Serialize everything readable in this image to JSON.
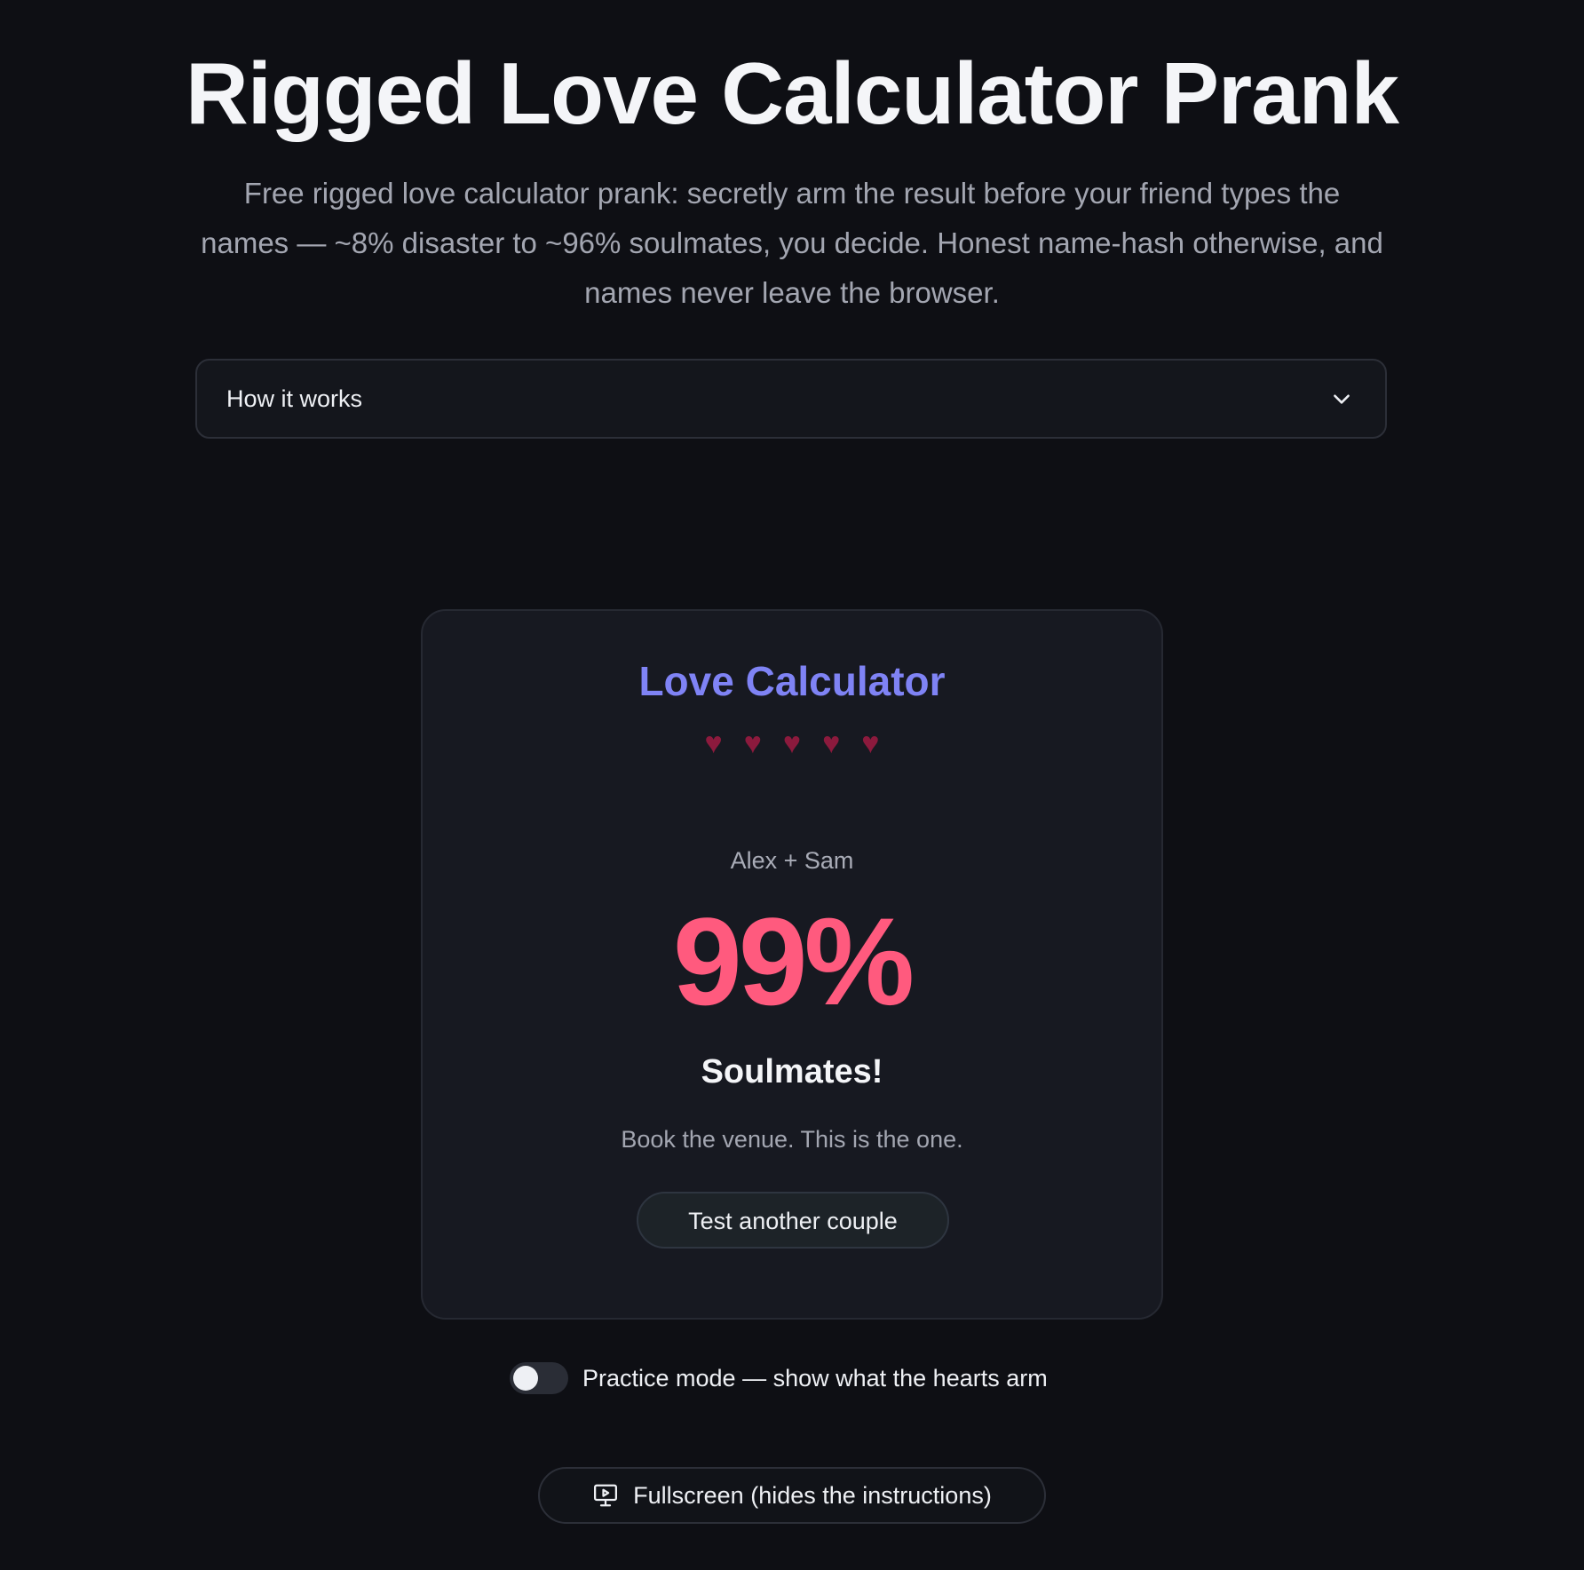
{
  "header": {
    "title": "Rigged Love Calculator Prank",
    "subtitle": "Free rigged love calculator prank: secretly arm the result before your friend types the names — ~8% disaster to ~96% soulmates, you decide. Honest name-hash otherwise, and names never leave the browser."
  },
  "how_it_works": {
    "label": "How it works",
    "icon": "chevron-down-icon"
  },
  "calculator": {
    "title": "Love Calculator",
    "hearts": [
      "♥",
      "♥",
      "♥",
      "♥",
      "♥"
    ],
    "names": "Alex + Sam",
    "percent": "99%",
    "verdict": "Soulmates!",
    "caption": "Book the venue. This is the one.",
    "retry_label": "Test another couple"
  },
  "practice_mode": {
    "label": "Practice mode — show what the hearts arm",
    "enabled": false
  },
  "fullscreen": {
    "label": "Fullscreen (hides the instructions)",
    "icon": "presentation-screen-icon"
  },
  "colors": {
    "background": "#0e0f14",
    "card": "#171921",
    "accent": "#7f83f5",
    "percent": "#ff5a7e",
    "heart": "#8c1a3d"
  }
}
